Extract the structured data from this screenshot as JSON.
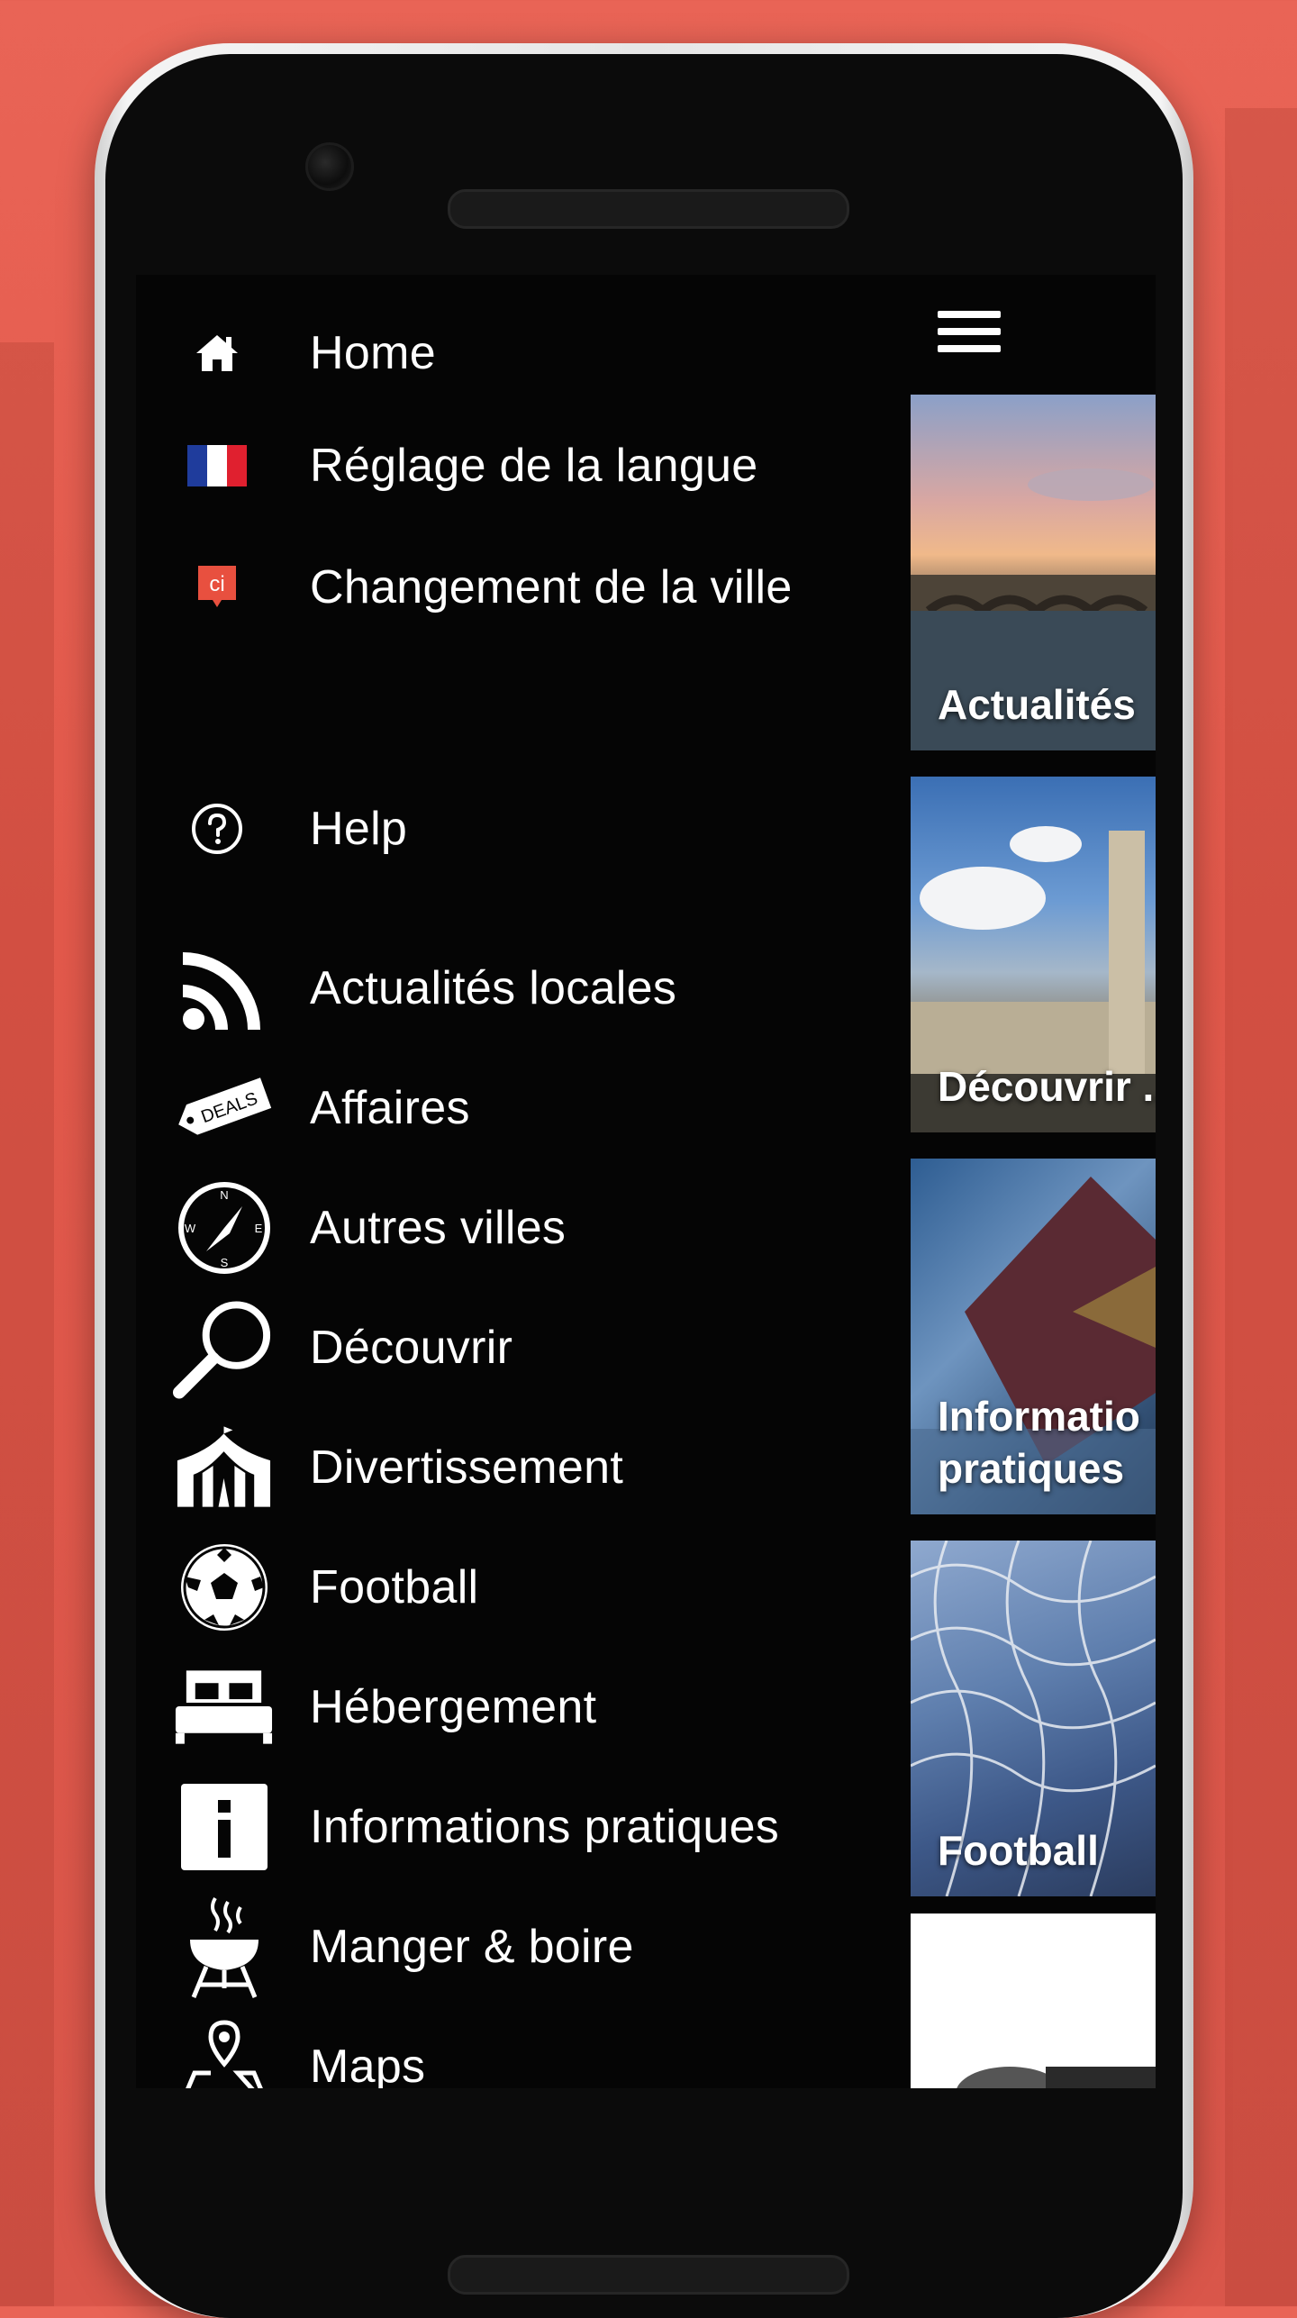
{
  "menu": {
    "items": [
      {
        "label": "Home",
        "icon": "home-icon"
      },
      {
        "label": "Réglage de la langue",
        "icon": "french-flag-icon"
      },
      {
        "label": "Changement de la ville",
        "icon": "city-badge-icon",
        "badge": "ci"
      },
      {
        "label": "Help",
        "icon": "help-circle-icon"
      },
      {
        "label": "Actualités locales",
        "icon": "rss-icon"
      },
      {
        "label": "Affaires",
        "icon": "deals-tag-icon",
        "badge": "DEALS"
      },
      {
        "label": "Autres villes",
        "icon": "compass-icon"
      },
      {
        "label": "Découvrir",
        "icon": "magnifier-icon"
      },
      {
        "label": "Divertissement",
        "icon": "circus-tent-icon"
      },
      {
        "label": "Football",
        "icon": "soccer-ball-icon"
      },
      {
        "label": "Hébergement",
        "icon": "bed-icon"
      },
      {
        "label": "Informations pratiques",
        "icon": "info-icon"
      },
      {
        "label": "Manger & boire",
        "icon": "grill-icon"
      },
      {
        "label": "Maps",
        "icon": "map-pin-icon"
      }
    ]
  },
  "tiles": [
    {
      "label": "Actualités"
    },
    {
      "label": "Découvrir ..."
    },
    {
      "label_line1": "Informatio",
      "label_line2": "pratiques"
    },
    {
      "label": "Football"
    }
  ],
  "colors": {
    "background": "#e3594b",
    "screen": "#050505",
    "text": "#ffffff",
    "badge": "#e8503f"
  }
}
